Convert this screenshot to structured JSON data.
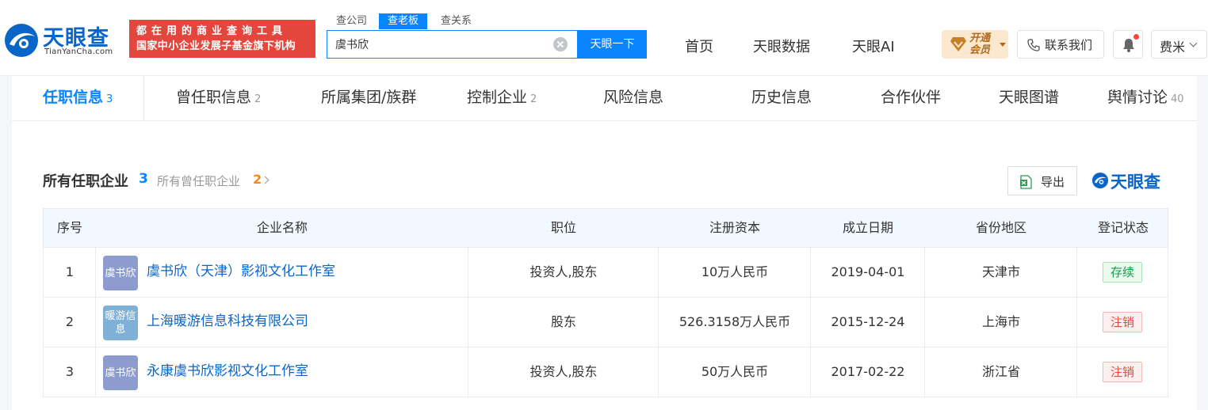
{
  "header": {
    "logo_cn": "天眼查",
    "logo_en": "TianYanCha.com",
    "slogan_line1": "都在用的商业查询工具",
    "slogan_line2": "国家中小企业发展子基金旗下机构",
    "search_tabs": [
      "查公司",
      "查老板",
      "查关系"
    ],
    "search_value": "虞书欣",
    "search_button": "天眼一下",
    "nav": [
      "首页",
      "天眼数据",
      "天眼AI"
    ],
    "vip_line1": "开通",
    "vip_line2": "会员",
    "contact": "联系我们",
    "user": "费米"
  },
  "tabs": [
    {
      "label": "任职信息",
      "count": "3"
    },
    {
      "label": "曾任职信息",
      "count": "2"
    },
    {
      "label": "所属集团/族群",
      "count": ""
    },
    {
      "label": "控制企业",
      "count": "2"
    },
    {
      "label": "风险信息",
      "count": ""
    },
    {
      "label": "历史信息",
      "count": ""
    },
    {
      "label": "合作伙伴",
      "count": ""
    },
    {
      "label": "天眼图谱",
      "count": ""
    },
    {
      "label": "舆情讨论",
      "count": "40"
    }
  ],
  "section": {
    "title": "所有任职企业",
    "count": "3",
    "former_label": "所有曾任职企业",
    "former_count": "2",
    "export": "导出",
    "brand": "天眼查"
  },
  "table": {
    "headers": [
      "序号",
      "企业名称",
      "职位",
      "注册资本",
      "成立日期",
      "省份地区",
      "登记状态"
    ],
    "rows": [
      {
        "index": "1",
        "logo_text": "虞书欣",
        "logo_color": "#8c9ccf",
        "name": "虞书欣（天津）影视文化工作室",
        "position": "投资人,股东",
        "capital": "10万人民币",
        "date": "2019-04-01",
        "region": "天津市",
        "status": "存续",
        "status_type": "ok"
      },
      {
        "index": "2",
        "logo_text": "暖游信息",
        "logo_color": "#7fb0d6",
        "name": "上海暖游信息科技有限公司",
        "position": "股东",
        "capital": "526.3158万人民币",
        "date": "2015-12-24",
        "region": "上海市",
        "status": "注销",
        "status_type": "bad"
      },
      {
        "index": "3",
        "logo_text": "虞书欣",
        "logo_color": "#8c9ccf",
        "name": "永康虞书欣影视文化工作室",
        "position": "投资人,股东",
        "capital": "50万人民币",
        "date": "2017-02-22",
        "region": "浙江省",
        "status": "注销",
        "status_type": "bad"
      }
    ]
  }
}
